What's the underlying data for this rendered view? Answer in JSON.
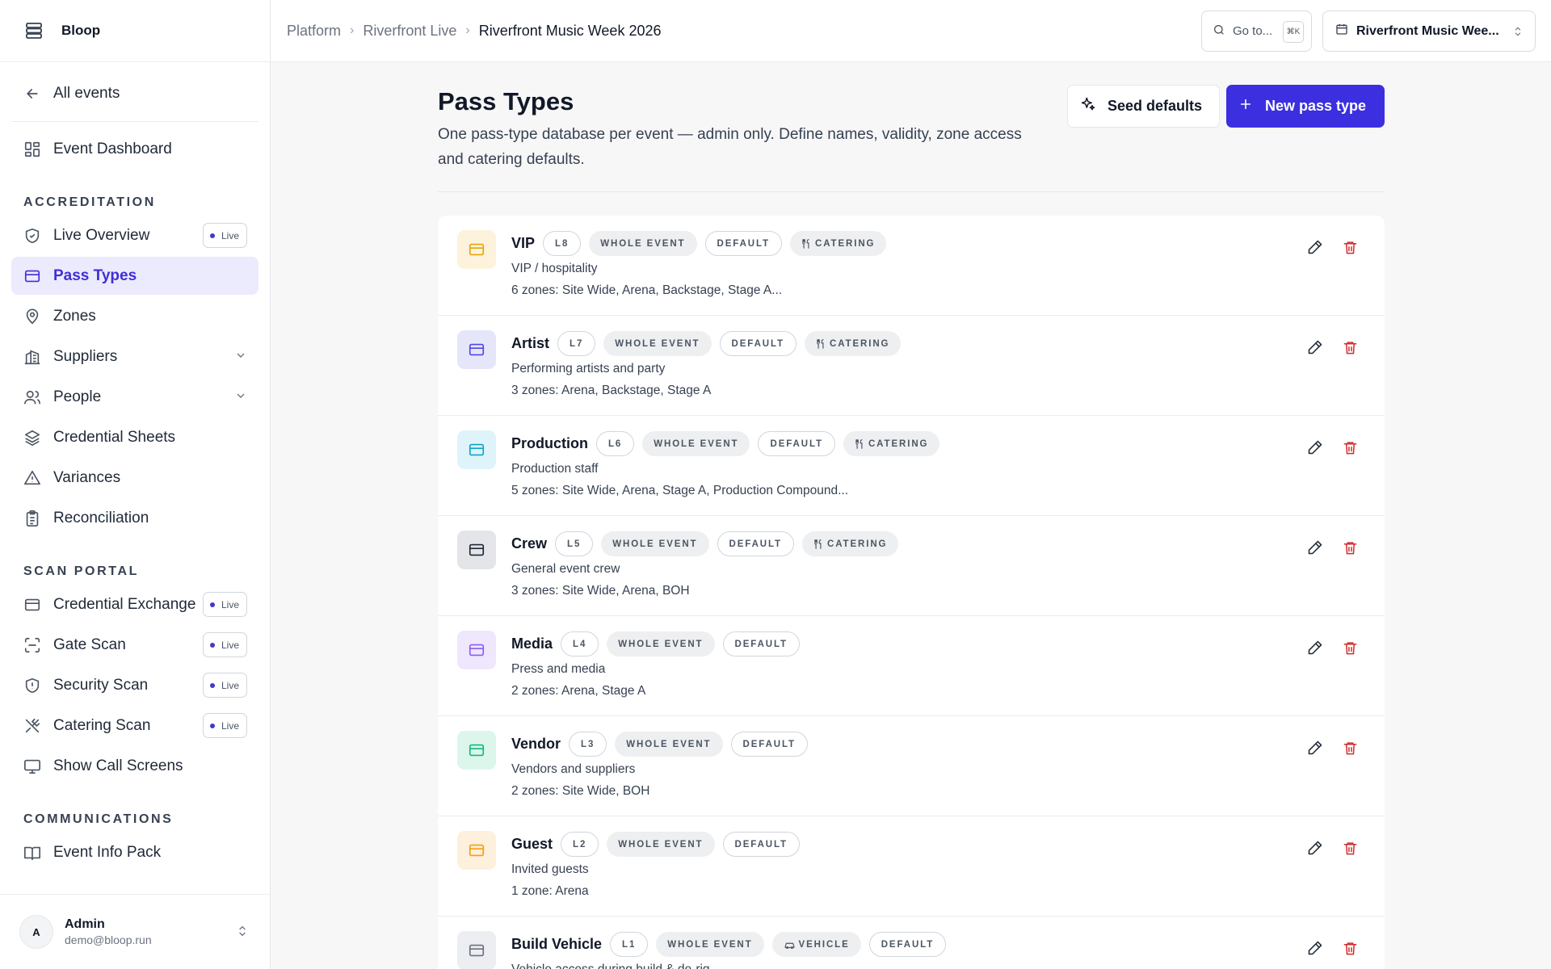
{
  "brand": {
    "name": "Bloop"
  },
  "breadcrumb": [
    "Platform",
    "Riverfront Live",
    "Riverfront Music Week 2026"
  ],
  "topbar": {
    "goto_label": "Go to...",
    "goto_kbd": "⌘K",
    "event_selector": "Riverfront Music Wee..."
  },
  "sidebar": {
    "back": "All events",
    "dashboard": "Event Dashboard",
    "sections": {
      "accreditation": "ACCREDITATION",
      "scan_portal": "SCAN PORTAL",
      "communications": "COMMUNICATIONS"
    },
    "items": {
      "live_overview": "Live Overview",
      "pass_types": "Pass Types",
      "zones": "Zones",
      "suppliers": "Suppliers",
      "people": "People",
      "credential_sheets": "Credential Sheets",
      "variances": "Variances",
      "reconciliation": "Reconciliation",
      "credential_exchange": "Credential Exchange",
      "gate_scan": "Gate Scan",
      "security_scan": "Security Scan",
      "catering_scan": "Catering Scan",
      "show_call_screens": "Show Call Screens",
      "event_info_pack": "Event Info Pack"
    },
    "live_label": "Live",
    "user": {
      "initial": "A",
      "name": "Admin",
      "email": "demo@bloop.run"
    }
  },
  "page": {
    "title": "Pass Types",
    "description": "One pass-type database per event — admin only. Define names, validity, zone access and catering defaults.",
    "seed_button": "Seed defaults",
    "new_button": "New pass type"
  },
  "colors": {
    "accent": "#3b2fe0",
    "danger": "#d02b2b"
  },
  "pass_types": [
    {
      "name": "VIP",
      "level": "L8",
      "whole": "WHOLE EVENT",
      "tags": [
        {
          "kind": "default",
          "label": "DEFAULT"
        },
        {
          "kind": "cater",
          "label": "CATERING"
        }
      ],
      "subtitle": "VIP / hospitality",
      "zones": "6 zones: Site Wide, Arena, Backstage, Stage A...",
      "icon_color": "#e5a50a",
      "icon_bg": "#fdf3dc"
    },
    {
      "name": "Artist",
      "level": "L7",
      "whole": "WHOLE EVENT",
      "tags": [
        {
          "kind": "default",
          "label": "DEFAULT"
        },
        {
          "kind": "cater",
          "label": "CATERING"
        }
      ],
      "subtitle": "Performing artists and party",
      "zones": "3 zones: Arena, Backstage, Stage A",
      "icon_color": "#4f46e5",
      "icon_bg": "#e6e6fb"
    },
    {
      "name": "Production",
      "level": "L6",
      "whole": "WHOLE EVENT",
      "tags": [
        {
          "kind": "default",
          "label": "DEFAULT"
        },
        {
          "kind": "cater",
          "label": "CATERING"
        }
      ],
      "subtitle": "Production staff",
      "zones": "5 zones: Site Wide, Arena, Stage A, Production Compound...",
      "icon_color": "#0ea5c6",
      "icon_bg": "#dff4fa"
    },
    {
      "name": "Crew",
      "level": "L5",
      "whole": "WHOLE EVENT",
      "tags": [
        {
          "kind": "default",
          "label": "DEFAULT"
        },
        {
          "kind": "cater",
          "label": "CATERING"
        }
      ],
      "subtitle": "General event crew",
      "zones": "3 zones: Site Wide, Arena, BOH",
      "icon_color": "#1f2937",
      "icon_bg": "#e4e5e8"
    },
    {
      "name": "Media",
      "level": "L4",
      "whole": "WHOLE EVENT",
      "tags": [
        {
          "kind": "default",
          "label": "DEFAULT"
        }
      ],
      "subtitle": "Press and media",
      "zones": "2 zones: Arena, Stage A",
      "icon_color": "#8b5cf6",
      "icon_bg": "#efe7fd"
    },
    {
      "name": "Vendor",
      "level": "L3",
      "whole": "WHOLE EVENT",
      "tags": [
        {
          "kind": "default",
          "label": "DEFAULT"
        }
      ],
      "subtitle": "Vendors and suppliers",
      "zones": "2 zones: Site Wide, BOH",
      "icon_color": "#10b981",
      "icon_bg": "#dcf6ec"
    },
    {
      "name": "Guest",
      "level": "L2",
      "whole": "WHOLE EVENT",
      "tags": [
        {
          "kind": "default",
          "label": "DEFAULT"
        }
      ],
      "subtitle": "Invited guests",
      "zones": "1 zone: Arena",
      "icon_color": "#f59e0b",
      "icon_bg": "#fdf0dc"
    },
    {
      "name": "Build Vehicle",
      "level": "L1",
      "whole": "WHOLE EVENT",
      "tags": [
        {
          "kind": "vehicle",
          "label": "VEHICLE"
        },
        {
          "kind": "default",
          "label": "DEFAULT"
        }
      ],
      "subtitle": "Vehicle access during build & de-rig",
      "zones": "",
      "icon_color": "#6b7280",
      "icon_bg": "#eceef1"
    }
  ]
}
